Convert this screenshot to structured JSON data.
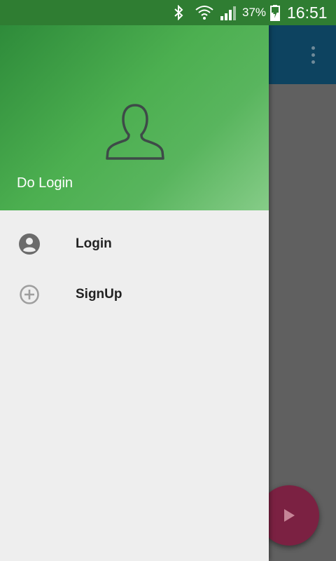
{
  "status_bar": {
    "battery": "37%",
    "time": "16:51",
    "icons": [
      "bluetooth-icon",
      "wifi-icon",
      "signal-icon",
      "battery-charging-icon"
    ]
  },
  "app_bar": {
    "overflow_icon": "more-vert-icon"
  },
  "drawer": {
    "header": {
      "avatar_icon": "user-outline-icon",
      "title": "Do Login"
    },
    "items": [
      {
        "label": "Login",
        "icon": "account-circle-icon"
      },
      {
        "label": "SignUp",
        "icon": "add-circle-icon"
      }
    ]
  },
  "fab": {
    "icon": "play-icon",
    "color": "#7b2142"
  },
  "colors": {
    "status_bar": "#2f7d32",
    "header_green": "#4caf50",
    "app_bar": "#0d4360",
    "drawer_bg": "#eeeeee",
    "scrim": "#606060"
  }
}
